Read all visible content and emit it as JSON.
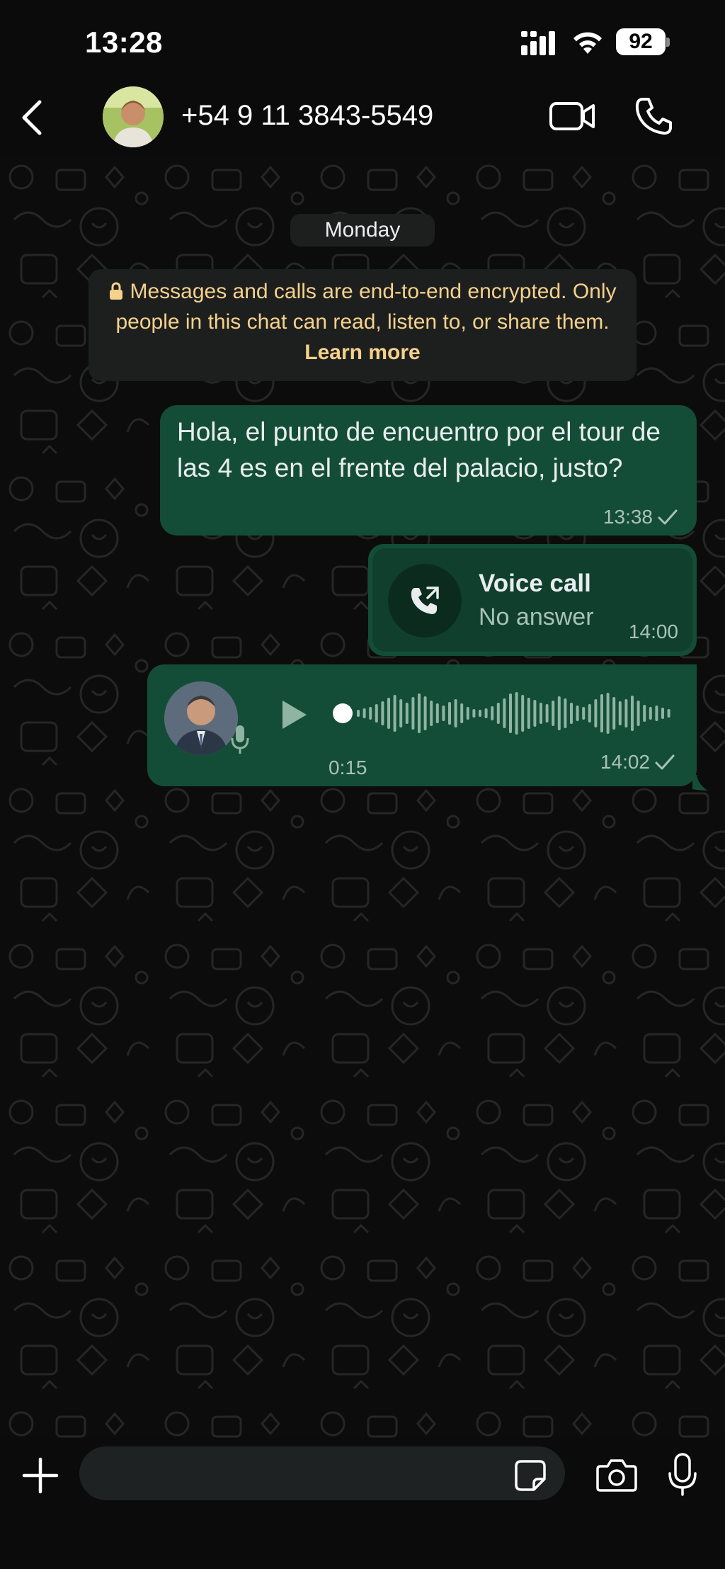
{
  "status_bar": {
    "time": "13:28",
    "battery": "92",
    "icons": [
      "signal-icon",
      "wifi-icon",
      "battery-icon"
    ]
  },
  "header": {
    "contact_name": "+54 9 11 3843-5549",
    "icons": [
      "back-icon",
      "video-call-icon",
      "phone-call-icon"
    ]
  },
  "chat": {
    "date_label": "Monday",
    "encryption_notice": {
      "text": "Messages and calls are end-to-end encrypted. Only people in this chat can read, listen to, or share them.",
      "link": "Learn more"
    },
    "messages": [
      {
        "type": "text",
        "direction": "outgoing",
        "text": "Hola, el punto de encuentro por el tour de las 4 es en el frente del palacio, justo?",
        "time": "13:38",
        "status": "sent"
      },
      {
        "type": "call",
        "direction": "outgoing",
        "title": "Voice call",
        "subtitle": "No answer",
        "time": "14:00"
      },
      {
        "type": "voice",
        "direction": "outgoing",
        "duration": "0:15",
        "time": "14:02",
        "status": "sent",
        "played_fraction": 0
      }
    ]
  },
  "input_bar": {
    "placeholder": "",
    "icons": [
      "plus-icon",
      "sticker-icon",
      "camera-icon",
      "microphone-icon"
    ]
  },
  "colors": {
    "background": "#0b0b0b",
    "outgoing_bubble": "#144d37",
    "system_chip": "#1d1f1f",
    "notice_text": "#f6d18b",
    "meta_text": "#a9c2b5"
  }
}
